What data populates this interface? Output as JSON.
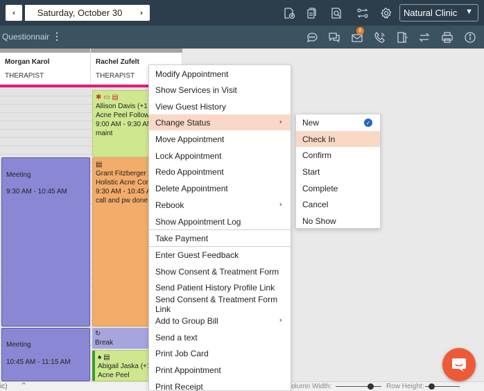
{
  "topbar": {
    "prev_label": "‹",
    "date": "Saturday, October 30",
    "next_label": "›",
    "clinic": "Natural Clinic"
  },
  "subbar": {
    "label": "Questionnair",
    "kebab": "⋮",
    "notification_count": "0"
  },
  "columns": [
    {
      "name": "Morgan Karol",
      "role": "THERAPIST"
    },
    {
      "name": "Rachel Zufelt",
      "role": "THERAPIST"
    }
  ],
  "appointments": {
    "allison": {
      "icons": "✱ ▭ ▤",
      "line1": "Allison Davis (+1 4",
      "line2": "Acne Peel Follow-",
      "line3": "9:00 AM - 9:30 AM",
      "line4": "maint"
    },
    "meeting1": {
      "title": "Meeting",
      "time": "9:30 AM - 10:45 AM"
    },
    "grant": {
      "icons": "▤",
      "line1": "Grant Fitzberger (",
      "line2": "Holistic Acne Con",
      "line3": "9:30 AM - 10:45 A",
      "line4": "call and pw done"
    },
    "meeting2": {
      "title": "Meeting",
      "time": "10:45 AM - 11:15 AM"
    },
    "break": {
      "icon": "↻",
      "title": "Break"
    },
    "abigail": {
      "icons": "♠ ▤",
      "line1": "Abigail Jaska (+1",
      "line2": "Acne Peel"
    }
  },
  "context_menu": {
    "items": [
      "Modify Appointment",
      "Show Services in Visit",
      "View Guest History",
      "Change Status",
      "Move Appointment",
      "Lock Appointment",
      "Redo Appointment",
      "Delete Appointment",
      "Rebook",
      "Show Appointment Log",
      "Take Payment",
      "Enter Guest Feedback",
      "Show Consent & Treatment Form",
      "Send Patient History Profile Link",
      "Send Consent & Treatment Form Link",
      "Add to Group Bill",
      "Send a text",
      "Print Job Card",
      "Print Appointment",
      "Print Receipt"
    ],
    "active_item": "Change Status"
  },
  "status_submenu": {
    "items": [
      "New",
      "Check In",
      "Confirm",
      "Start",
      "Complete",
      "Cancel",
      "No Show"
    ],
    "selected": "New",
    "hovered": "Check In"
  },
  "bottombar": {
    "left_text": "ic)",
    "caret": "^",
    "column_width_label": "olumn Width:",
    "row_height_label": "Row Height:"
  },
  "colors": {
    "topbar": "#2c3e4c",
    "subbar": "#3b5261",
    "pink_accent": "#e6177b",
    "menu_highlight": "#f9d9c6",
    "chat_button": "#ee5a38",
    "check_blue": "#2266c8"
  },
  "icons": {
    "toolbar": [
      "add-document-icon",
      "copy-document-icon",
      "search-document-icon",
      "transfer-icon",
      "settings-icon"
    ],
    "subbar": [
      "chat-icon",
      "messages-icon",
      "mail-icon",
      "phone-icon",
      "door-exit-icon",
      "swap-icon",
      "print-icon",
      "info-icon"
    ]
  }
}
